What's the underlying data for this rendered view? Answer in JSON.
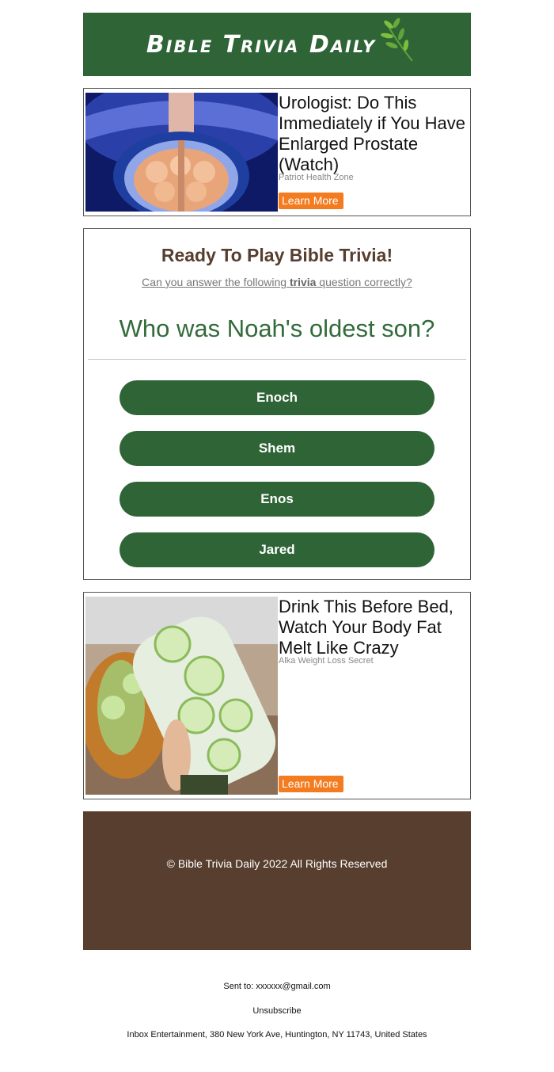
{
  "header": {
    "brand": "Bible Trivia Daily",
    "brand_color": "#2e6436",
    "logo_icon": "olive-branch-icon"
  },
  "ads": [
    {
      "image": "prostate-illustration-image",
      "title": "Urologist: Do This Immediately if You Have Enlarged Prostate (Watch)",
      "source": "Patriot Health Zone",
      "cta": "Learn More"
    },
    {
      "image": "cucumber-water-bottle-image",
      "title": "Drink This Before Bed, Watch Your Body Fat Melt Like Crazy",
      "source": "Alka Weight Loss Secret",
      "cta": "Learn More"
    }
  ],
  "trivia": {
    "heading": "Ready To Play Bible Trivia!",
    "subheading_before": "Can you answer the following ",
    "subheading_bold": "trivia",
    "subheading_after": " question correctly?",
    "question": "Who was Noah's oldest son?",
    "answers": [
      "Enoch",
      "Shem",
      "Enos",
      "Jared"
    ],
    "accent_color": "#336b3b"
  },
  "footer": {
    "copyright": "© Bible Trivia Daily 2022 All Rights Reserved",
    "bg_color": "#573e2f"
  },
  "meta": {
    "sent_to": "Sent to: xxxxxx@gmail.com",
    "unsubscribe": "Unsubscribe",
    "address": "Inbox Entertainment, 380 New York Ave, Huntington, NY 11743, United States"
  },
  "cta_color": "#f47c20"
}
